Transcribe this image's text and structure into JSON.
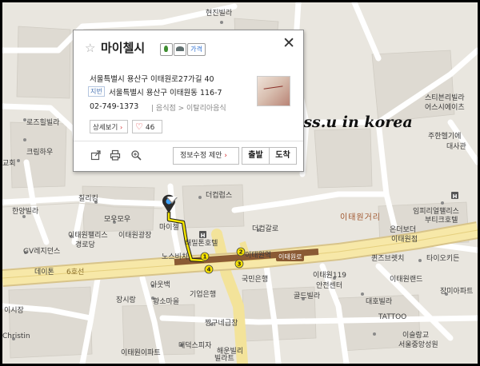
{
  "popup": {
    "name": "마이첼시",
    "star_icon": "star-icon",
    "badge_price": "가격",
    "close_icon": "close-icon",
    "road_address": "서울특별시 용산구 이태원로27가길 40",
    "jibun_tag": "지번",
    "jibun_address": "서울특별시 용산구 이태원동 116-7",
    "phone": "02-749-1373",
    "category_sep": "|",
    "category": "음식점 > 이탈리아음식",
    "detail_label": "상세보기",
    "detail_arrow": "›",
    "like_count": "46",
    "heart_icon": "heart-icon",
    "edit_label": "정보수정 제안",
    "edit_arrow": "›",
    "depart_label": "출발",
    "arrive_label": "도착"
  },
  "watermark": "miss.u in korea",
  "map": {
    "street_name": "이태원거리",
    "station_label": "이태원역",
    "station_tag": "이태원로",
    "road_label": "6호선",
    "exit_numbers": [
      "1",
      "2",
      "3",
      "4"
    ],
    "labels": [
      "현진빌라",
      "로즈힐빌라",
      "크림하우",
      "교회",
      "칠리킹",
      "한양빌라",
      "모우모우",
      "이태원팰리스",
      "이태원광장",
      "경로당",
      "GV레지던스",
      "데이톤",
      "노스비치",
      "마이첼",
      "해밀톤호텔",
      "더컵갈로",
      "더컵럽스",
      "스티븐리빌라",
      "어스시에이츠",
      "주한헬기에",
      "대사관",
      "임피리얼팰리스",
      "부티크호텔",
      "온더보더",
      "이태원점",
      "퀸즈브렛치",
      "타이오키든",
      "이태원119",
      "안전센터",
      "국민은행",
      "이태원랜드",
      "장미아파트",
      "골드빌라",
      "대호빌라",
      "TATTOO",
      "이슬람교",
      "서울중앙성원",
      "아웃백",
      "황소마을",
      "장시랑",
      "기업은행",
      "짱구네급창",
      "이시장",
      "Christin",
      "이태원이파트",
      "매덕스피자",
      "해운빌리",
      "빌라트"
    ]
  }
}
